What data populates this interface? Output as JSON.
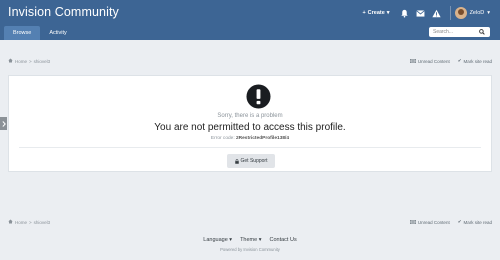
{
  "header": {
    "brand": "Invision Community",
    "tabs": [
      {
        "label": "Browse"
      },
      {
        "label": "Activity"
      }
    ],
    "create_label": "Create",
    "user_name": "ZeloD",
    "search_placeholder": "Search..."
  },
  "breadcrumb": {
    "home": "Home",
    "separator": ">",
    "current": "shiovel3"
  },
  "actions": {
    "unread": "Unread Content",
    "mark_read": "Mark site read"
  },
  "error": {
    "sorry": "Sorry, there is a problem",
    "message": "You are not permitted to access this profile.",
    "code_prefix": "Error code:",
    "code": "2RestrictedProfile138/4",
    "support_label": "Get Support"
  },
  "footer": {
    "language": "Language",
    "theme": "Theme",
    "contact": "Contact Us",
    "powered": "Powered by Invision Community"
  },
  "colors": {
    "header_bg": "#3d6594",
    "active_tab": "#5480b2",
    "page_bg": "#ebeef2"
  }
}
